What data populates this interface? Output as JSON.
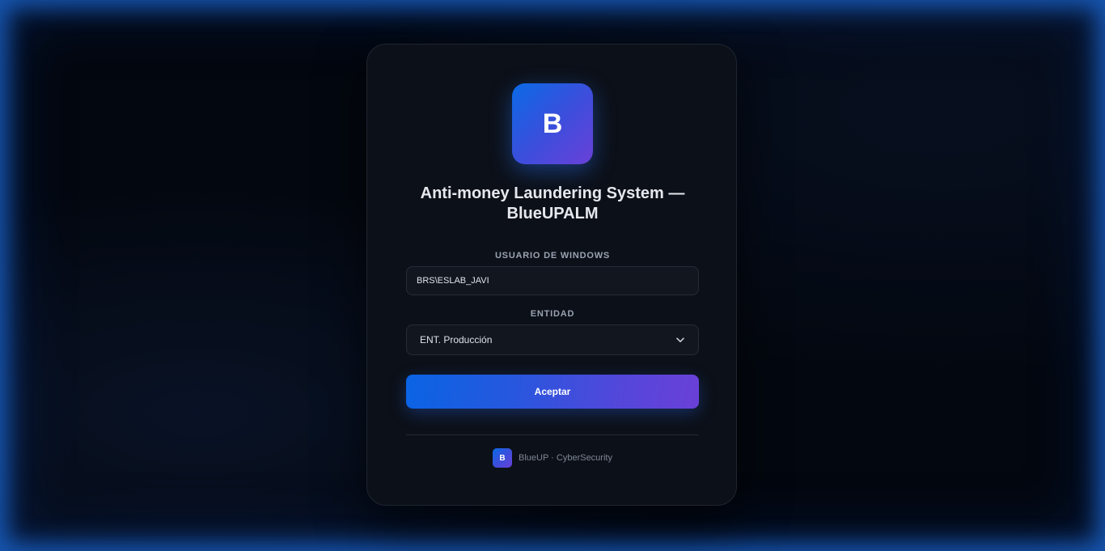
{
  "app": {
    "logo_letter": "B",
    "title": "Anti-money Laundering System — BlueUPALM"
  },
  "form": {
    "user_label": "USUARIO DE WINDOWS",
    "user_value": "BRS\\ESLAB_JAVI",
    "entity_label": "ENTIDAD",
    "entity_selected": "ENT. Producción",
    "submit_label": "Aceptar"
  },
  "footer": {
    "logo_letter": "B",
    "text": "BlueUP · CyberSecurity"
  },
  "colors": {
    "accent_start": "#0a6ae6",
    "accent_end": "#6a40d8",
    "card_bg": "#0c1018",
    "border_glow": "#1e6edc"
  },
  "icons": {
    "select_arrow": "chevron-down-icon"
  }
}
